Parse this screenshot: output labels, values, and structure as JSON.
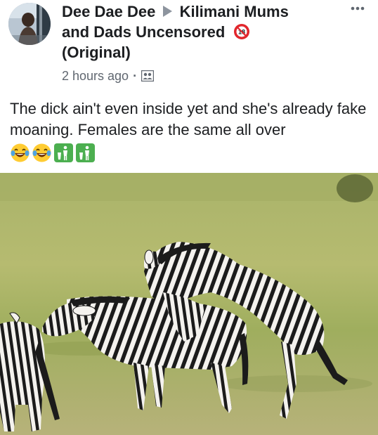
{
  "post": {
    "author": "Dee Dae Dee",
    "group_line1": "Kilimani Mums",
    "group_line2": "and Dads Uncensored",
    "group_line3": "(Original)",
    "timestamp": "2 hours ago",
    "text": "The dick ain't even inside yet and she's already fake moaning. Females are the same all over",
    "emojis": [
      "laughing-crying-emoji",
      "laughing-crying-emoji",
      "restroom-sign-emoji",
      "restroom-sign-emoji"
    ]
  },
  "icons": {
    "arrow": "triangle-right-icon",
    "badge": "no-under-18-icon",
    "audience": "group-audience-icon",
    "more": "more-options-icon"
  },
  "colors": {
    "text": "#1c1e21",
    "secondary": "#606770",
    "badge_red": "#e1262c",
    "emoji_green": "#4caf50",
    "emoji_yellow": "#ffcc33"
  }
}
